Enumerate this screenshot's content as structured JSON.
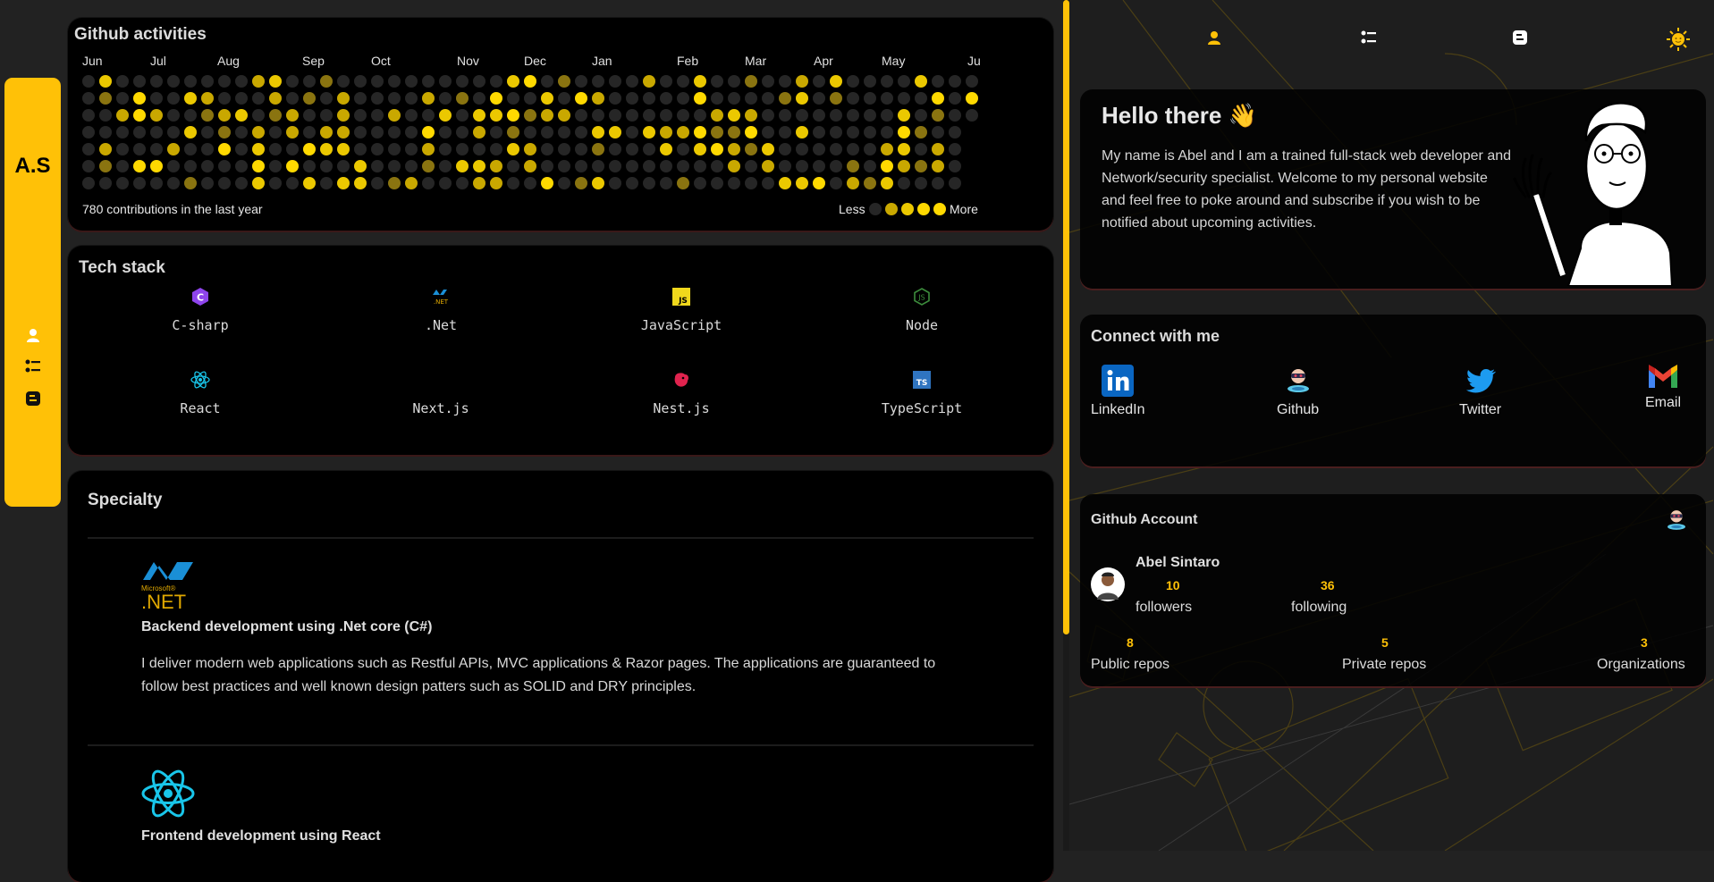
{
  "sidebar": {
    "logo": "A.S",
    "nav_icons": [
      "user-icon",
      "list-icon",
      "blog-icon"
    ]
  },
  "github_activity": {
    "title": "Github activities",
    "months": [
      "Jun",
      "Jul",
      "Aug",
      "Sep",
      "Oct",
      "Nov",
      "Dec",
      "Jan",
      "Feb",
      "Mar",
      "Apr",
      "May",
      "Ju"
    ],
    "summary": "780 contributions in the last year",
    "legend_less": "Less",
    "legend_more": "More",
    "colors": {
      "empty": "#262626",
      "l1": "#8a7410",
      "l2": "#c9a800",
      "l3": "#ebc800",
      "l4": "#ffd900"
    }
  },
  "tech_stack": {
    "title": "Tech stack",
    "items": [
      {
        "label": "C-sharp",
        "icon": "csharp-icon"
      },
      {
        "label": ".Net",
        "icon": "dotnet-icon"
      },
      {
        "label": "JavaScript",
        "icon": "javascript-icon"
      },
      {
        "label": "Node",
        "icon": "node-icon"
      },
      {
        "label": "React",
        "icon": "react-icon"
      },
      {
        "label": "Next.js",
        "icon": "nextjs-icon"
      },
      {
        "label": "Nest.js",
        "icon": "nestjs-icon"
      },
      {
        "label": "TypeScript",
        "icon": "typescript-icon"
      }
    ]
  },
  "specialty": {
    "title": "Specialty",
    "items": [
      {
        "logo_small": "Microsoft®",
        "logo_text": ".NET",
        "heading": "Backend development using .Net core (C#)",
        "body": "I deliver modern web applications such as Restful APIs, MVC applications & Razor pages. The applications are guaranteed to follow best practices and well known design patters such as SOLID and DRY principles."
      },
      {
        "heading": "Frontend development using React"
      }
    ]
  },
  "top_nav": {
    "icons": [
      "user-icon",
      "list-icon",
      "blog-icon",
      "sun-icon"
    ]
  },
  "hello": {
    "title": "Hello there 👋",
    "text": "My name is Abel and I am a trained full-stack web developer and Network/security specialist. Welcome to my personal website and feel free to poke around and subscribe if you wish to be notified about upcoming activities."
  },
  "connect": {
    "title": "Connect with me",
    "links": [
      {
        "label": "LinkedIn",
        "icon": "linkedin-icon"
      },
      {
        "label": "Github",
        "icon": "github-icon"
      },
      {
        "label": "Twitter",
        "icon": "twitter-icon"
      },
      {
        "label": "Email",
        "icon": "gmail-icon"
      }
    ]
  },
  "github_account": {
    "title": "Github Account",
    "name": "Abel Sintaro",
    "followers": "10",
    "followers_label": "followers",
    "following": "36",
    "following_label": "following",
    "public_repos": "8",
    "public_repos_label": "Public repos",
    "private_repos": "5",
    "private_repos_label": "Private repos",
    "organizations": "3",
    "organizations_label": "Organizations"
  },
  "colors": {
    "accent": "#ffc107",
    "card": "#000000",
    "page": "#222222"
  }
}
